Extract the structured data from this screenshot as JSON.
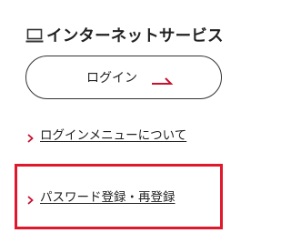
{
  "section": {
    "title": "インターネットサービス",
    "title_icon": "laptop-icon"
  },
  "login_button": {
    "label": "ログイン",
    "arrow_icon": "arrow-right-icon"
  },
  "links": [
    {
      "label": "ログインメニューについて",
      "icon": "chevron-right-icon"
    },
    {
      "label": "パスワード登録・再登録",
      "icon": "chevron-right-icon"
    }
  ],
  "colors": {
    "accent": "#c8102e",
    "highlight": "#e0182b",
    "text": "#222222"
  }
}
